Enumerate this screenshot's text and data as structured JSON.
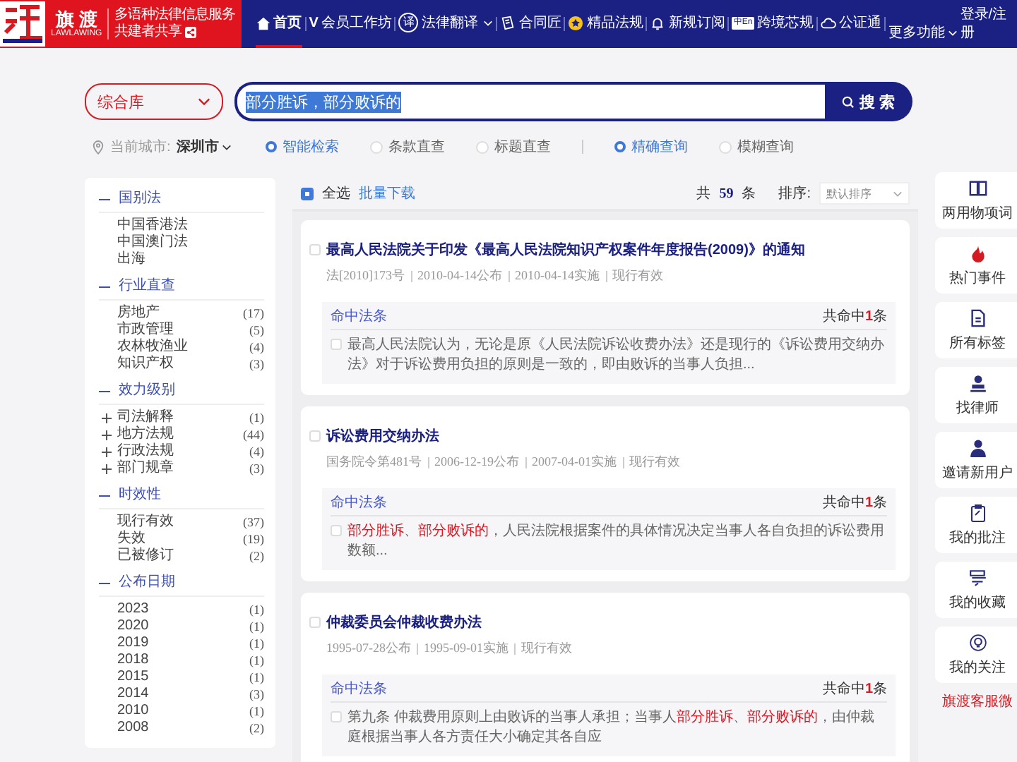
{
  "header": {
    "logo_name": "旗 渡",
    "logo_sub": "LAWLAWING",
    "tagline": "多语种法律信息服务",
    "tagline2": "共建者共享",
    "nav": [
      {
        "label": "首页",
        "kind": "home",
        "selected": true
      },
      {
        "label": "会员工作坊",
        "kind": "letter",
        "icon_text": "V",
        "selected": false
      },
      {
        "label": "法律翻译",
        "kind": "circle",
        "icon_text": "译",
        "dropdown": true,
        "selected": false
      },
      {
        "label": "合同匠",
        "kind": "contract",
        "selected": false
      },
      {
        "label": "精品法规",
        "kind": "star",
        "selected": false
      },
      {
        "label": "新规订阅",
        "kind": "bell",
        "selected": false
      },
      {
        "label": "跨境芯规",
        "kind": "badge",
        "icon_text": "中En",
        "selected": false
      },
      {
        "label": "公证通",
        "kind": "cloud",
        "selected": false
      }
    ],
    "login": "登录/注册",
    "more": "更多功能"
  },
  "search": {
    "library": "综合库",
    "query": "部分胜诉，部分败诉的",
    "query_selected": true,
    "button": "搜 索"
  },
  "filters": {
    "city_label": "当前城市:",
    "city": "深圳市",
    "modes": [
      {
        "label": "智能检索",
        "selected": true
      },
      {
        "label": "条款直查",
        "selected": false
      },
      {
        "label": "标题直查",
        "selected": false
      }
    ],
    "matches": [
      {
        "label": "精确查询",
        "selected": true
      },
      {
        "label": "模糊查询",
        "selected": false
      }
    ]
  },
  "sidebar": [
    {
      "title": "国别法",
      "expanded": true,
      "items": [
        {
          "label": "中国香港法"
        },
        {
          "label": "中国澳门法"
        },
        {
          "label": "出海"
        }
      ]
    },
    {
      "title": "行业直查",
      "expanded": true,
      "items": [
        {
          "label": "房地产",
          "count": "(17)"
        },
        {
          "label": "市政管理",
          "count": "(5)"
        },
        {
          "label": "农林牧渔业",
          "count": "(4)"
        },
        {
          "label": "知识产权",
          "count": "(3)"
        }
      ]
    },
    {
      "title": "效力级别",
      "expanded": true,
      "items": [
        {
          "label": "司法解释",
          "count": "(1)",
          "expanded": false
        },
        {
          "label": "地方法规",
          "count": "(44)",
          "expanded": false
        },
        {
          "label": "行政法规",
          "count": "(4)",
          "expanded": false
        },
        {
          "label": "部门规章",
          "count": "(3)",
          "expanded": false
        }
      ]
    },
    {
      "title": "时效性",
      "expanded": true,
      "items": [
        {
          "label": "现行有效",
          "count": "(37)"
        },
        {
          "label": "失效",
          "count": "(19)"
        },
        {
          "label": "已被修订",
          "count": "(2)"
        }
      ]
    },
    {
      "title": "公布日期",
      "expanded": true,
      "items": [
        {
          "label": "2023",
          "count": "(1)"
        },
        {
          "label": "2020",
          "count": "(1)"
        },
        {
          "label": "2019",
          "count": "(1)"
        },
        {
          "label": "2018",
          "count": "(1)"
        },
        {
          "label": "2015",
          "count": "(1)"
        },
        {
          "label": "2014",
          "count": "(3)"
        },
        {
          "label": "2010",
          "count": "(1)"
        },
        {
          "label": "2008",
          "count": "(2)"
        }
      ]
    }
  ],
  "results": {
    "select_all": "全选",
    "select_all_checked": true,
    "batch": "批量下载",
    "total_prefix": "共",
    "total": "59",
    "total_suffix": "条",
    "sort_label": "排序:",
    "sort": "默认排序",
    "items": [
      {
        "title": "最高人民法院关于印发《最高人民法院知识产权案件年度报告(2009)》的通知",
        "checked": false,
        "meta": [
          "法[2010]173号",
          "2010-04-14公布",
          "2010-04-14实施",
          "现行有效"
        ],
        "hit_label": "命中法条",
        "hit_count": "共命中**1**条",
        "snippet_checked": false,
        "snippet": "最高人民法院认为，无论是原《人民法院诉讼收费办法》还是现行的《诉讼费用交纳办法》对于诉讼费用负担的原则是一致的，即由败诉的当事人负担..."
      },
      {
        "title": "诉讼费用交纳办法",
        "checked": false,
        "meta": [
          "国务院令第481号",
          "2006-12-19公布",
          "2007-04-01实施",
          "现行有效"
        ],
        "hit_label": "命中法条",
        "hit_count": "共命中**1**条",
        "snippet_checked": false,
        "snippet": "**部分胜诉**、**部分败诉的**，人民法院根据案件的具体情况决定当事人各自负担的诉讼费用数额..."
      },
      {
        "title": "仲裁委员会仲裁收费办法",
        "checked": false,
        "meta": [
          "1995-07-28公布",
          "1995-09-01实施",
          "现行有效"
        ],
        "hit_label": "命中法条",
        "hit_count": "共命中**1**条",
        "snippet_checked": false,
        "snippet": "第九条 仲裁费用原则上由败诉的当事人承担；当事人**部分胜诉**、**部分败诉的**，由仲裁庭根据当事人各方责任大小确定其各自应"
      }
    ]
  },
  "tools": [
    {
      "label": "两用物项词",
      "kind": "book"
    },
    {
      "label": "热门事件",
      "kind": "flame"
    },
    {
      "label": "所有标签",
      "kind": "document"
    },
    {
      "label": "找律师",
      "kind": "stamp"
    },
    {
      "label": "邀请新用户",
      "kind": "person"
    },
    {
      "label": "我的批注",
      "kind": "clipboard"
    },
    {
      "label": "我的收藏",
      "kind": "stack"
    },
    {
      "label": "我的关注",
      "kind": "bulb"
    }
  ],
  "service": "旗渡客服微"
}
